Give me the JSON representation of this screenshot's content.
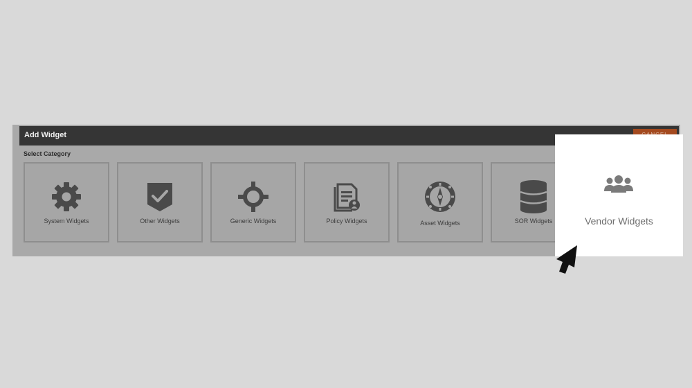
{
  "dialog": {
    "title": "Add Widget",
    "cancel_label": "CANCEL",
    "category_heading": "Select Category"
  },
  "categories": [
    {
      "label": "System Widgets",
      "icon": "gear-icon"
    },
    {
      "label": "Other Widgets",
      "icon": "shield-check-icon"
    },
    {
      "label": "Generic Widgets",
      "icon": "crosshair-icon"
    },
    {
      "label": "Policy Widgets",
      "icon": "policy-document-icon"
    },
    {
      "label": "Asset Widgets",
      "icon": "asset-compass-icon"
    },
    {
      "label": "SOR Widgets",
      "icon": "database-icon"
    },
    {
      "label": "Vendor Widgets",
      "icon": "users-icon"
    }
  ],
  "colors": {
    "titlebar": "#353535",
    "cancel_button": "#a44a1f",
    "tile_background": "#a6a6a6",
    "icon_dark": "#4a4a4a",
    "highlight_background": "#ffffff",
    "highlight_icon": "#7a7a7a"
  }
}
